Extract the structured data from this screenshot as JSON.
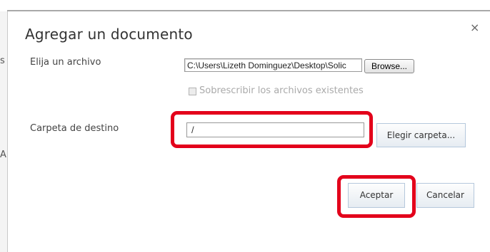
{
  "dialog": {
    "title": "Agregar un documento",
    "close_glyph": "×"
  },
  "file_section": {
    "label": "Elija un archivo",
    "file_path_value": "C:\\Users\\Lizeth Dominguez\\Desktop\\Solic",
    "browse_label": "Browse..."
  },
  "overwrite": {
    "label": "Sobrescribir los archivos existentes",
    "checked": false,
    "enabled": false
  },
  "destination": {
    "label": "Carpeta de destino",
    "value": "/",
    "choose_folder_label": "Elegir carpeta..."
  },
  "actions": {
    "accept_label": "Aceptar",
    "cancel_label": "Cancelar"
  },
  "page_edge": {
    "glyphs": [
      "s",
      "A"
    ]
  },
  "colors": {
    "highlight": "#e3001b",
    "button_border": "#b5c8dc",
    "disabled_text": "#aaaaaa"
  }
}
